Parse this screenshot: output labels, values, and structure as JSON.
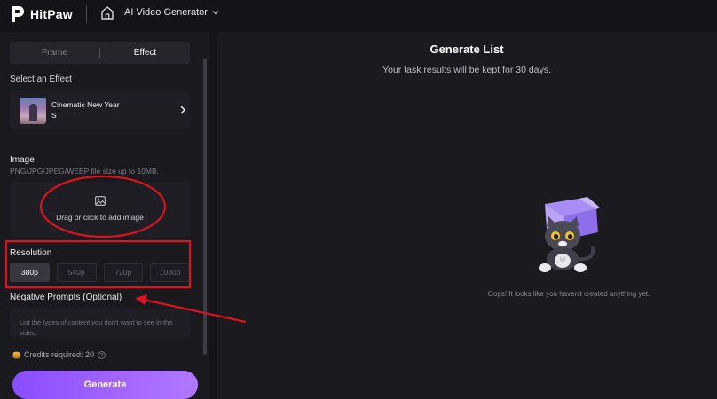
{
  "app": {
    "name": "HitPaw",
    "current_tool": "AI Video Generator"
  },
  "tabs": [
    {
      "label": "Frame",
      "active": false
    },
    {
      "label": "Effect",
      "active": true
    }
  ],
  "effect": {
    "section_label": "Select an Effect",
    "name": "Cinematic New Year S"
  },
  "image": {
    "label": "Image",
    "hint": "PNG/JPG/JPEG/WEBP file size up to 10MB.",
    "drop_text": "Drag or click to add image"
  },
  "resolution": {
    "label": "Resolution",
    "options": [
      "380p",
      "540p",
      "720p",
      "1080p"
    ],
    "selected": "380p"
  },
  "negative_prompts": {
    "label": "Negative Prompts (Optional)",
    "placeholder": "List the types of content you don't want to see in the video."
  },
  "credits": {
    "text": "Credits required: 20"
  },
  "generate": {
    "label": "Generate"
  },
  "generate_list": {
    "title": "Generate List",
    "subtitle": "Your task results will be kept for 30 days.",
    "empty_text": "Oops! It looks like you haven't created anything yet."
  },
  "colors": {
    "accent": "#9b5cff",
    "annotation_red": "#d9141e",
    "background": "#141318",
    "panel": "#1a191e"
  },
  "icons": [
    "hitpaw-logo-icon",
    "home-icon",
    "chevron-down-icon",
    "chevron-right-icon",
    "image-icon",
    "coin-icon",
    "help-icon"
  ]
}
